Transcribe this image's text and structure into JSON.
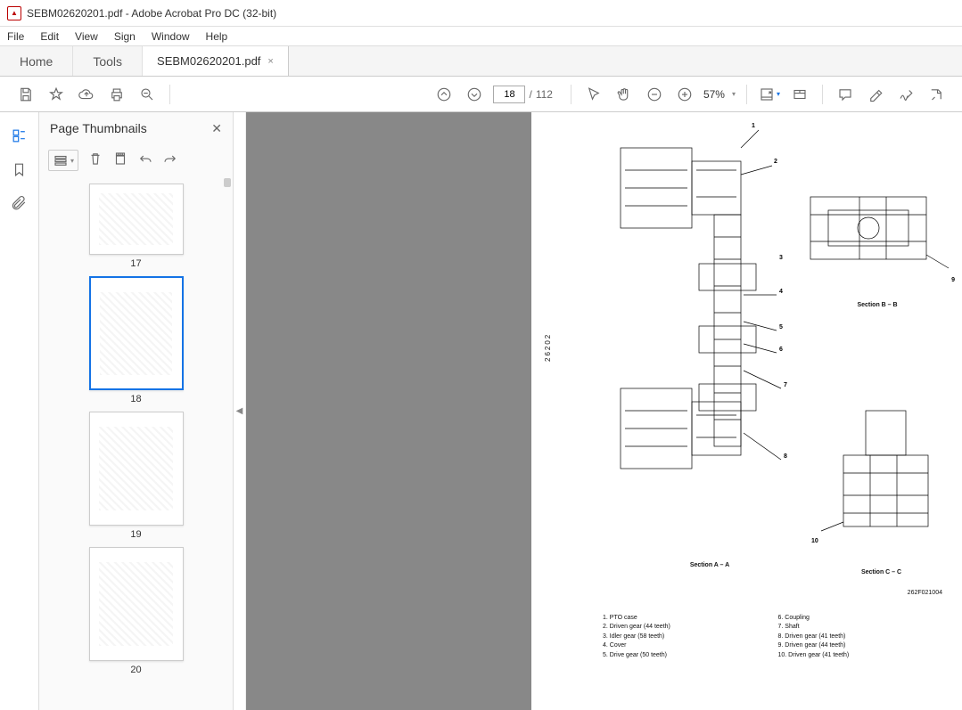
{
  "title": "SEBM02620201.pdf - Adobe Acrobat Pro DC (32-bit)",
  "menu": {
    "file": "File",
    "edit": "Edit",
    "view": "View",
    "sign": "Sign",
    "window": "Window",
    "help": "Help"
  },
  "tabs": {
    "home": "Home",
    "tools": "Tools",
    "doc": "SEBM02620201.pdf",
    "close": "×"
  },
  "toolbar": {
    "page_current": "18",
    "page_sep": "/",
    "page_total": "112",
    "zoom": "57%",
    "zoom_arrow": "▾"
  },
  "panel": {
    "title": "Page Thumbnails",
    "close": "✕"
  },
  "thumbs": {
    "items": [
      {
        "num": "17"
      },
      {
        "num": "18",
        "active": true
      },
      {
        "num": "19"
      },
      {
        "num": "20"
      }
    ]
  },
  "collapse": "◀",
  "document": {
    "side_number": "26202",
    "section_a": "Section A – A",
    "section_b": "Section B – B",
    "section_c": "Section C – C",
    "fig_ref": "262F021004",
    "callouts": {
      "n1": "1",
      "n2": "2",
      "n3": "3",
      "n4": "4",
      "n5": "5",
      "n6": "6",
      "n7": "7",
      "n8": "8",
      "n9": "9",
      "n10": "10"
    },
    "legend": {
      "l1": "1.  PTO case",
      "l2": "2.  Driven gear (44 teeth)",
      "l3": "3.  Idler gear (58 teeth)",
      "l4": "4.  Cover",
      "l5": "5.  Drive gear (50 teeth)",
      "l6": "6.  Coupling",
      "l7": "7.  Shaft",
      "l8": "8.  Driven gear (41 teeth)",
      "l9": "9.  Driven gear (44 teeth)",
      "l10": "10.  Driven gear (41 teeth)"
    }
  }
}
